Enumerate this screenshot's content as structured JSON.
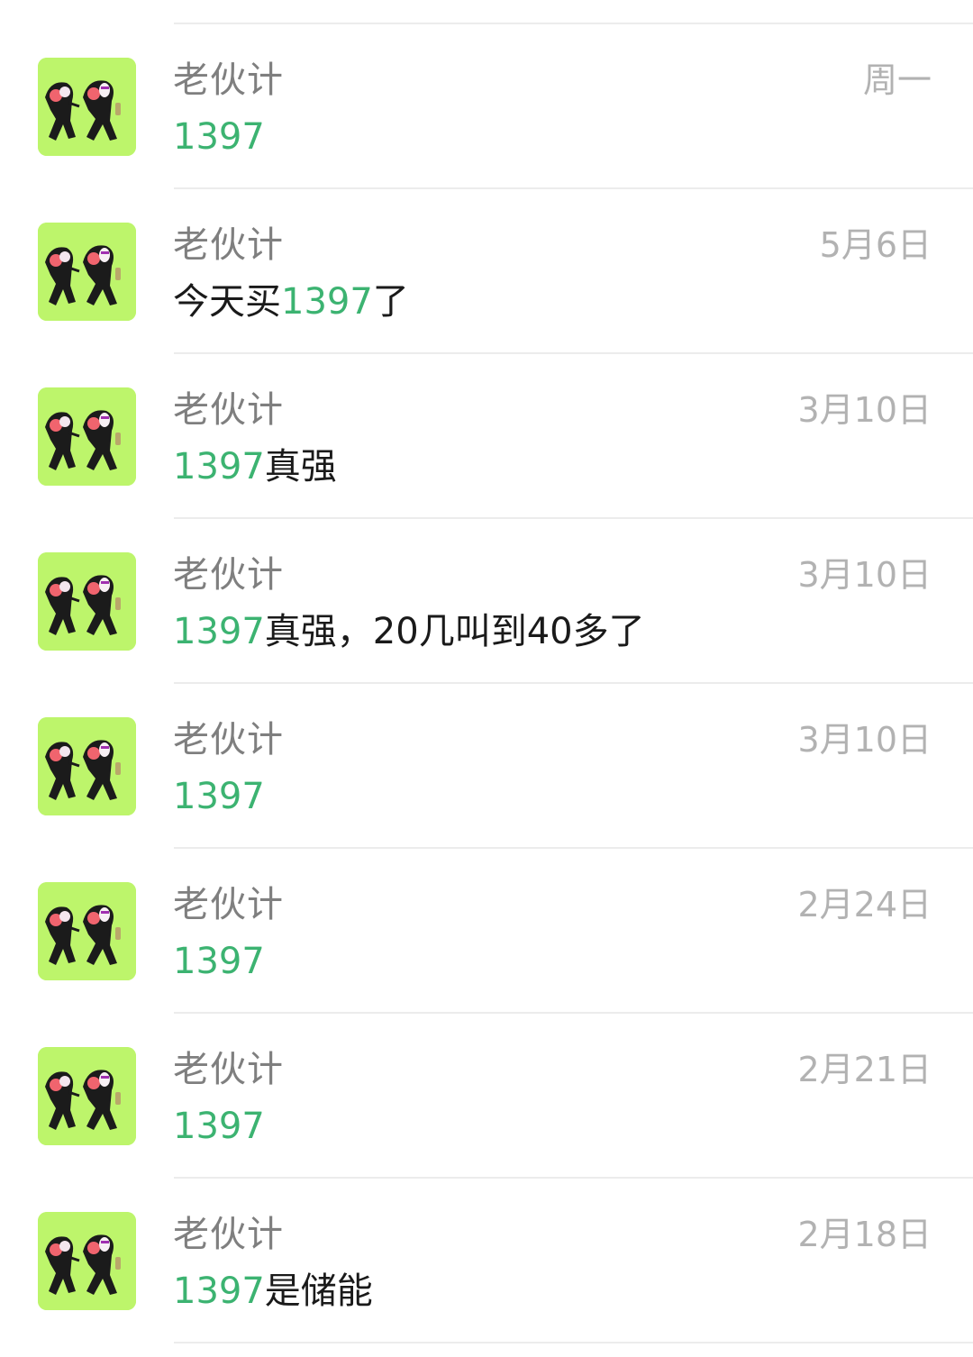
{
  "chats": [
    {
      "name": "老伙计",
      "date": "周一",
      "pre": "",
      "hl": "1397",
      "post": ""
    },
    {
      "name": "老伙计",
      "date": "5月6日",
      "pre": "今天买",
      "hl": "1397",
      "post": "了"
    },
    {
      "name": "老伙计",
      "date": "3月10日",
      "pre": "",
      "hl": "1397",
      "post": "真强"
    },
    {
      "name": "老伙计",
      "date": "3月10日",
      "pre": "",
      "hl": "1397",
      "post": "真强，20几叫到40多了"
    },
    {
      "name": "老伙计",
      "date": "3月10日",
      "pre": "",
      "hl": "1397",
      "post": ""
    },
    {
      "name": "老伙计",
      "date": "2月24日",
      "pre": "",
      "hl": "1397",
      "post": ""
    },
    {
      "name": "老伙计",
      "date": "2月21日",
      "pre": "",
      "hl": "1397",
      "post": ""
    },
    {
      "name": "老伙计",
      "date": "2月18日",
      "pre": "",
      "hl": "1397",
      "post": "是储能"
    }
  ],
  "theme": {
    "highlight_color": "#3cb371",
    "avatar_bg": "#bdf56b",
    "avatar_icon": "cartoon-pair-avatar-icon"
  }
}
